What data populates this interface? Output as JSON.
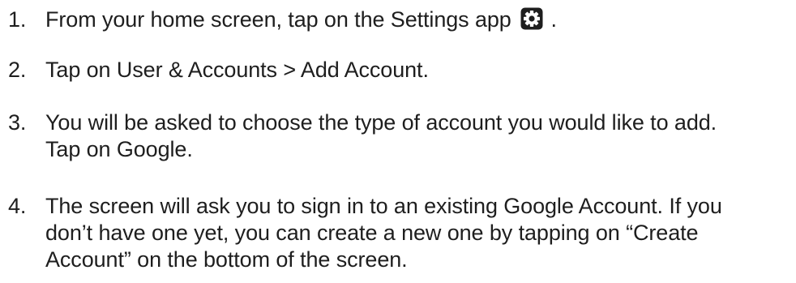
{
  "steps": [
    {
      "number": "1.",
      "line1_before_icon": "From your home screen, tap on the Settings app",
      "icon": "settings-gear-icon",
      "line1_after_icon": "."
    },
    {
      "number": "2.",
      "line1": "Tap on User & Accounts > Add Account."
    },
    {
      "number": "3.",
      "line1": "You will be asked to choose the type of account you would like to add.",
      "line2": "Tap on Google."
    },
    {
      "number": "4.",
      "line1": "The screen will ask you to sign in to an existing Google Account. If you",
      "line2": "don’t have one yet, you can create a new one by tapping on “Create",
      "line3": "Account” on the bottom of the screen."
    }
  ]
}
